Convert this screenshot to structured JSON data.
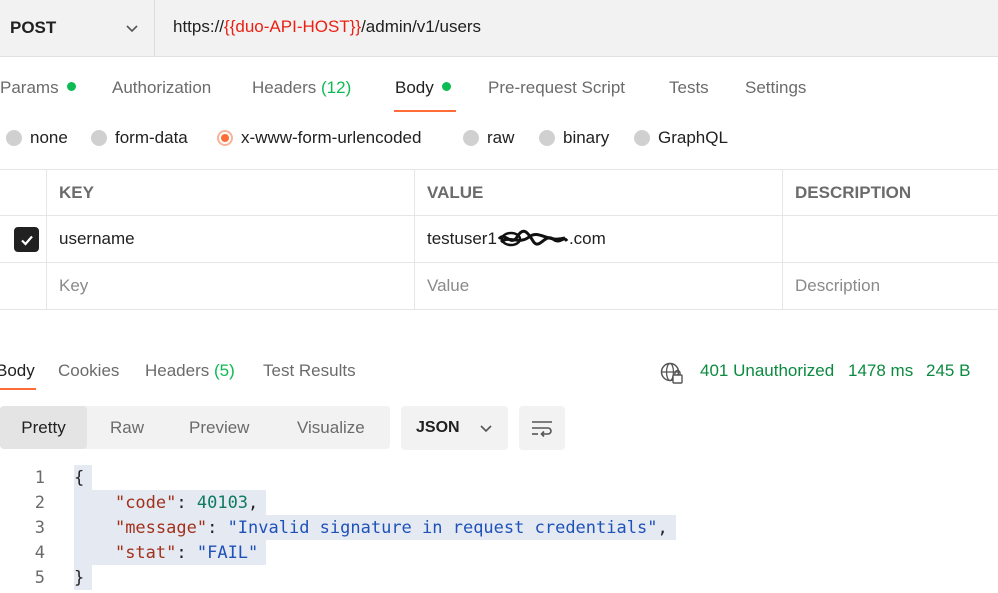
{
  "request": {
    "method": "POST",
    "url_prefix": "https://",
    "url_variable": "{{duo-API-HOST}}",
    "url_suffix": "/admin/v1/users"
  },
  "request_tabs": [
    {
      "label": "Params",
      "dot": true
    },
    {
      "label": "Authorization"
    },
    {
      "label": "Headers",
      "count": "(12)"
    },
    {
      "label": "Body",
      "dot": true,
      "active": true
    },
    {
      "label": "Pre-request Script"
    },
    {
      "label": "Tests"
    },
    {
      "label": "Settings"
    }
  ],
  "body_types": [
    "none",
    "form-data",
    "x-www-form-urlencoded",
    "raw",
    "binary",
    "GraphQL"
  ],
  "body_type_selected": "x-www-form-urlencoded",
  "params_table": {
    "headers": [
      "KEY",
      "VALUE",
      "DESCRIPTION"
    ],
    "rows": [
      {
        "checked": true,
        "key": "username",
        "value_prefix": "testuser1",
        "value_suffix": ".com",
        "description": ""
      }
    ],
    "placeholders": {
      "key": "Key",
      "value": "Value",
      "description": "Description"
    }
  },
  "response_tabs": [
    {
      "label": "Body",
      "active": true
    },
    {
      "label": "Cookies"
    },
    {
      "label": "Headers",
      "count": "(5)"
    },
    {
      "label": "Test Results"
    }
  ],
  "response_status": {
    "status": "401 Unauthorized",
    "time": "1478 ms",
    "size": "245 B"
  },
  "view_modes": [
    "Pretty",
    "Raw",
    "Preview",
    "Visualize"
  ],
  "format": "JSON",
  "code_lines": [
    {
      "n": "1",
      "parts": [
        {
          "t": "{",
          "c": "punc"
        }
      ]
    },
    {
      "n": "2",
      "parts": [
        {
          "t": "    ",
          "c": "punc"
        },
        {
          "t": "\"code\"",
          "c": "key"
        },
        {
          "t": ": ",
          "c": "punc"
        },
        {
          "t": "40103",
          "c": "num"
        },
        {
          "t": ",",
          "c": "punc"
        }
      ]
    },
    {
      "n": "3",
      "parts": [
        {
          "t": "    ",
          "c": "punc"
        },
        {
          "t": "\"message\"",
          "c": "key"
        },
        {
          "t": ": ",
          "c": "punc"
        },
        {
          "t": "\"Invalid signature in request credentials\"",
          "c": "str"
        },
        {
          "t": ",",
          "c": "punc"
        }
      ]
    },
    {
      "n": "4",
      "parts": [
        {
          "t": "    ",
          "c": "punc"
        },
        {
          "t": "\"stat\"",
          "c": "key"
        },
        {
          "t": ": ",
          "c": "punc"
        },
        {
          "t": "\"FAIL\"",
          "c": "str"
        }
      ]
    },
    {
      "n": "5",
      "parts": [
        {
          "t": "}",
          "c": "punc"
        }
      ]
    }
  ],
  "colors": {
    "accent": "#ff6c37",
    "success": "#0cbb52",
    "url_variable": "#eb2013"
  }
}
